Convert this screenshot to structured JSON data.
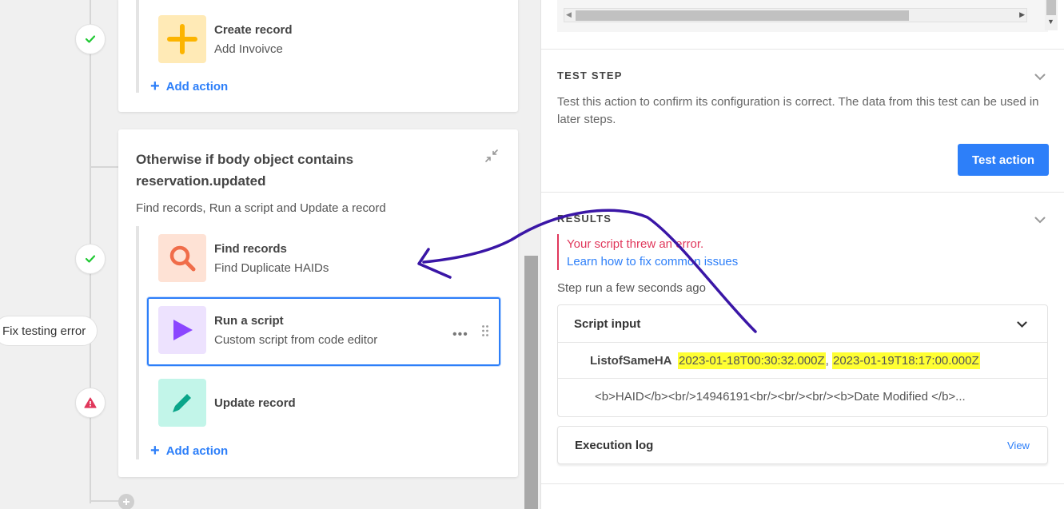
{
  "workflow": {
    "fix_pill": "Fix testing error",
    "card1": {
      "action": {
        "title": "Create record",
        "subtitle": "Add Invoivce"
      },
      "add_action": "Add action"
    },
    "card2": {
      "title": "Otherwise if body object contains reservation.updated",
      "subtitle": "Find records, Run a script and Update a record",
      "actions": [
        {
          "title": "Find records",
          "subtitle": "Find Duplicate HAIDs"
        },
        {
          "title": "Run a script",
          "subtitle": "Custom script from code editor"
        },
        {
          "title": "Update record",
          "subtitle": ""
        }
      ],
      "more": "•••",
      "add_action": "Add action"
    }
  },
  "panel": {
    "test_step": {
      "title": "TEST STEP",
      "description": "Test this action to confirm its configuration is correct. The data from this test can be used in later steps.",
      "button": "Test action"
    },
    "results": {
      "title": "RESULTS",
      "error": "Your script threw an error.",
      "help_link": "Learn how to fix common issues",
      "step_run": "Step run a few seconds ago",
      "script_input": {
        "title": "Script input",
        "key": "ListofSameHA",
        "value1": "2023-01-18T00:30:32.000Z",
        "sep": ", ",
        "value2": "2023-01-19T18:17:00.000Z",
        "row2": "<b>HAID</b><br/>14946191<br/><br/><br/><b>Date Modified </b>..."
      },
      "execution_log": {
        "title": "Execution log",
        "view": "View"
      }
    }
  },
  "colors": {
    "accent": "#2d7ff9",
    "error": "#e0375b",
    "success": "#20c933",
    "annotation": "#3a16a6",
    "highlight": "#ffff33"
  }
}
